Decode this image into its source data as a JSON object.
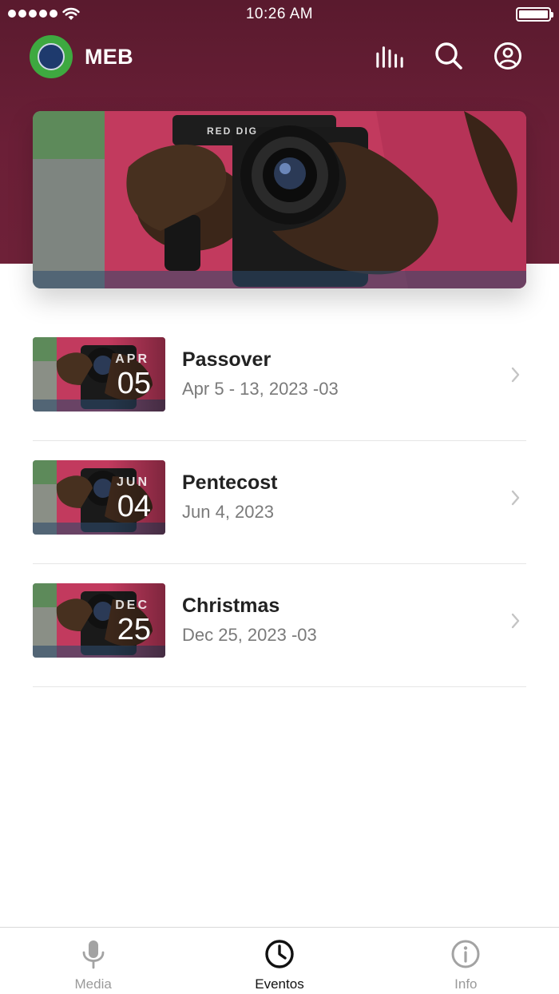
{
  "status_bar": {
    "time": "10:26 AM"
  },
  "app": {
    "name": "MEB"
  },
  "icons": {
    "audio": "equalizer-icon",
    "search": "search-icon",
    "account": "user-circle-icon"
  },
  "colors": {
    "header": "#6b1f37",
    "logo_green": "#3ea940"
  },
  "events": [
    {
      "title": "Passover",
      "date": "Apr 5 - 13, 2023 -03",
      "month": "APR",
      "day": "05"
    },
    {
      "title": "Pentecost",
      "date": "Jun 4, 2023",
      "month": "JUN",
      "day": "04"
    },
    {
      "title": "Christmas",
      "date": "Dec 25, 2023 -03",
      "month": "DEC",
      "day": "25"
    }
  ],
  "tabs": [
    {
      "label": "Media",
      "icon": "microphone-icon",
      "active": false
    },
    {
      "label": "Eventos",
      "icon": "clock-icon",
      "active": true
    },
    {
      "label": "Info",
      "icon": "info-icon",
      "active": false
    }
  ]
}
